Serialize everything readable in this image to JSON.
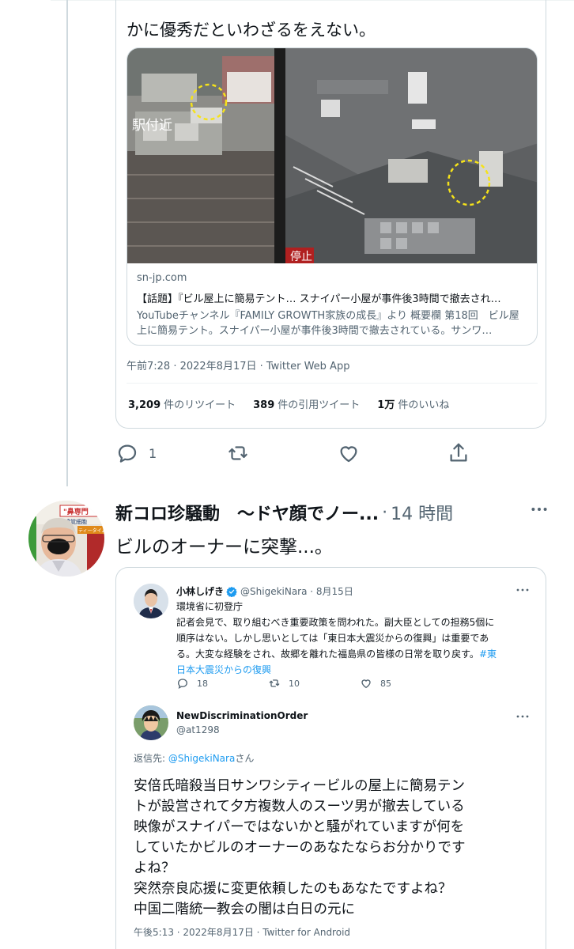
{
  "quoted_tweet": {
    "text_tail": "かに優秀だといわざるをえない。",
    "card": {
      "domain": "sn-jp.com",
      "title": "【話題】『ビル屋上に簡易テント… スナイパー小屋が事件後3時間で撤去され…",
      "description": "YouTubeチャンネル『FAMILY GROWTH家族の成長』より 概要欄 第18回　ビル屋上に簡易テント。スナイパー小屋が事件後3時間で撤去されている。サンワ…",
      "image_overlay_left": "駅付近",
      "image_overlay_right": "停止"
    },
    "timestamp": "午前7:28 · 2022年8月17日 · Twitter Web App",
    "stats": [
      {
        "count": "3,209",
        "label": "件のリツイート"
      },
      {
        "count": "389",
        "label": "件の引用ツイート"
      },
      {
        "count": "1万",
        "label": "件のいいね"
      }
    ]
  },
  "actions": {
    "reply_count": "1"
  },
  "tweet": {
    "author_name": "新コロ珍騒動　〜ドヤ顔でノー...",
    "separator": "·",
    "time": "14 時間",
    "text": "ビルのオーナーに突撃...。",
    "avatar_caption_1": "\"鼻専門",
    "avatar_caption_2": "嗅覚細胞",
    "avatar_caption_3": "ティータイム"
  },
  "embedded": {
    "first": {
      "name": "小林しげき",
      "handle": "@ShigekiNara · 8月15日",
      "body_lines": [
        "環境省に初登庁",
        "記者会見で、取り組むべき重要政策を問われた。副大臣としての担務5個に",
        "順序はない。しかし思いとしては「東日本大震災からの復興」は重要であ",
        "る。大変な経験をされ、故郷を離れた福島県の皆様の日常を取り戻す。"
      ],
      "hashtag_a": "#東",
      "hashtag_b": "日本大震災からの復興",
      "reply_count": "18",
      "retweet_count": "10",
      "like_count": "85"
    },
    "second": {
      "name": "NewDiscriminationOrder",
      "handle": "@at1298",
      "reply_prefix": "返信先: ",
      "reply_mention": "@ShigekiNara",
      "reply_suffix": "さん",
      "body": "安倍氏暗殺当日サンワシティービルの屋上に簡易テン\nトが設営されて夕方複数人のスーツ男が撤去している\n映像がスナイパーではないかと騒がれていますが何を\nしていたかビルのオーナーのあなたならお分かりです\nよね？\n突然奈良応援に変更依頼したのもあなたですよね？\n中国二階統一教会の闇は白日の元に",
      "footer": "午後5:13 · 2022年8月17日 · Twitter for Android"
    }
  },
  "colors": {
    "accent_blue": "#1d9bf0",
    "secondary_text": "#536471",
    "highlight_circle": "#f5e21a"
  }
}
